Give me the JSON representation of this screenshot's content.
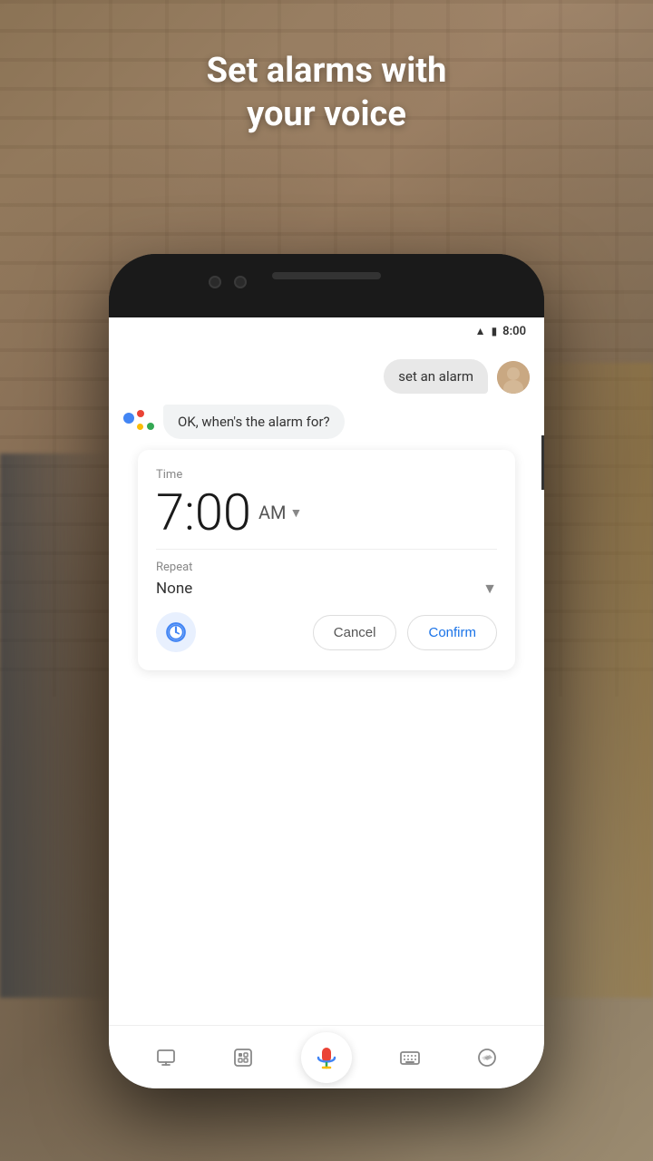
{
  "hero": {
    "title": "Set alarms with\nyour voice"
  },
  "status_bar": {
    "time": "8:00"
  },
  "chat": {
    "user_message": "set an alarm",
    "assistant_message": "OK, when's the alarm for?"
  },
  "alarm_card": {
    "time_label": "Time",
    "hours": "7:00",
    "ampm": "AM",
    "repeat_label": "Repeat",
    "repeat_value": "None",
    "cancel_label": "Cancel",
    "confirm_label": "Confirm"
  },
  "bottom_nav": {
    "items": [
      {
        "name": "tv-icon",
        "symbol": "⊟",
        "label": "TV"
      },
      {
        "name": "lens-icon",
        "symbol": "⊡",
        "label": "Lens"
      },
      {
        "name": "mic-icon",
        "label": "Mic"
      },
      {
        "name": "keyboard-icon",
        "symbol": "⌨",
        "label": "Keyboard"
      },
      {
        "name": "compass-icon",
        "symbol": "◎",
        "label": "Explore"
      }
    ]
  }
}
